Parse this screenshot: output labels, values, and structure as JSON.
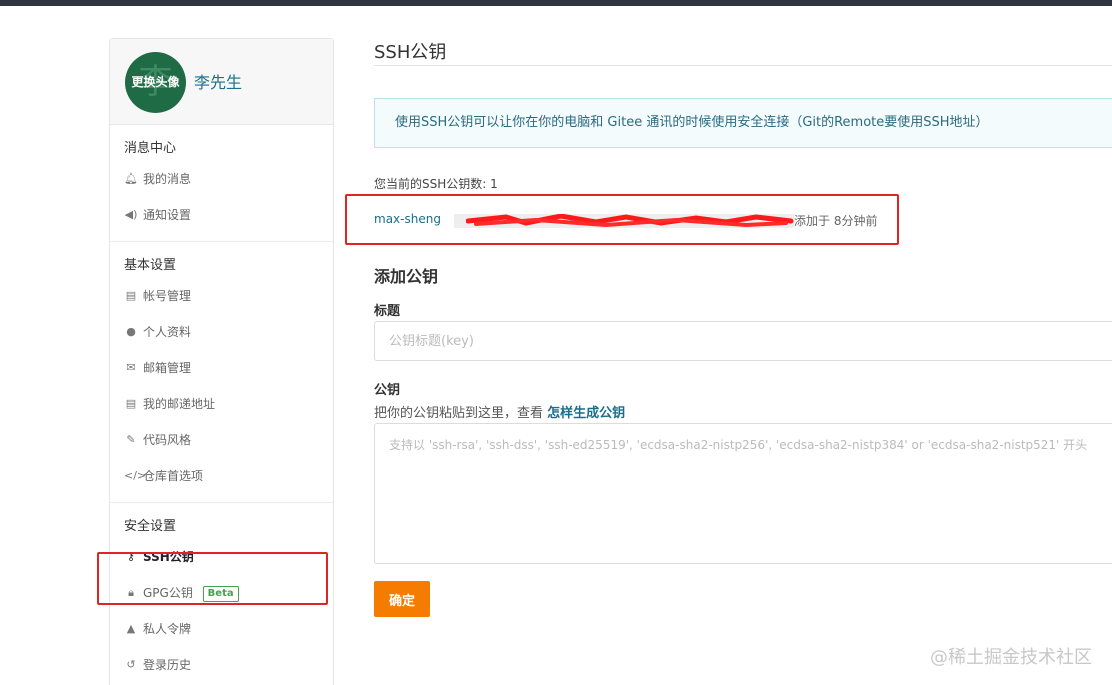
{
  "user": {
    "avatar_char": "李",
    "avatar_overlay": "更换头像",
    "name": "李先生"
  },
  "sidebar": {
    "groups": [
      {
        "title": "消息中心",
        "items": [
          {
            "label": "我的消息",
            "icon": "bell-icon"
          },
          {
            "label": "通知设置",
            "icon": "speaker-icon"
          }
        ]
      },
      {
        "title": "基本设置",
        "items": [
          {
            "label": "帐号管理",
            "icon": "id-card-icon"
          },
          {
            "label": "个人资料",
            "icon": "user-icon"
          },
          {
            "label": "邮箱管理",
            "icon": "mail-icon"
          },
          {
            "label": "我的邮递地址",
            "icon": "id-card-icon"
          },
          {
            "label": "代码风格",
            "icon": "brush-icon"
          },
          {
            "label": "仓库首选项",
            "icon": "code-icon"
          }
        ]
      },
      {
        "title": "安全设置",
        "items": [
          {
            "label": "SSH公钥",
            "icon": "key-icon",
            "active": true
          },
          {
            "label": "GPG公钥",
            "icon": "lock-icon",
            "badge": "Beta"
          },
          {
            "label": "私人令牌",
            "icon": "token-icon"
          },
          {
            "label": "登录历史",
            "icon": "history-icon"
          }
        ]
      }
    ]
  },
  "main": {
    "title": "SSH公钥",
    "info": "使用SSH公钥可以让你在你的电脑和 Gitee 通讯的时候使用安全连接（Git的Remote要使用SSH地址）",
    "key_count_label": "您当前的SSH公钥数: 1",
    "keys": [
      {
        "name": "max-sheng",
        "time": "添加于 8分钟前"
      }
    ],
    "add_title": "添加公钥",
    "title_label": "标题",
    "title_placeholder": "公钥标题(key)",
    "key_label": "公钥",
    "hint_text": "把你的公钥粘贴到这里，查看 ",
    "hint_link": "怎样生成公钥",
    "key_placeholder": "支持以 'ssh-rsa', 'ssh-dss', 'ssh-ed25519', 'ecdsa-sha2-nistp256', 'ecdsa-sha2-nistp384' or 'ecdsa-sha2-nistp521' 开头",
    "confirm": "确定"
  },
  "watermark": "@稀土掘金技术社区",
  "colors": {
    "accent_orange": "#f57c00",
    "link": "#1a6f8a",
    "highlight_red": "#e02424",
    "beta_green": "#3ea54e"
  }
}
